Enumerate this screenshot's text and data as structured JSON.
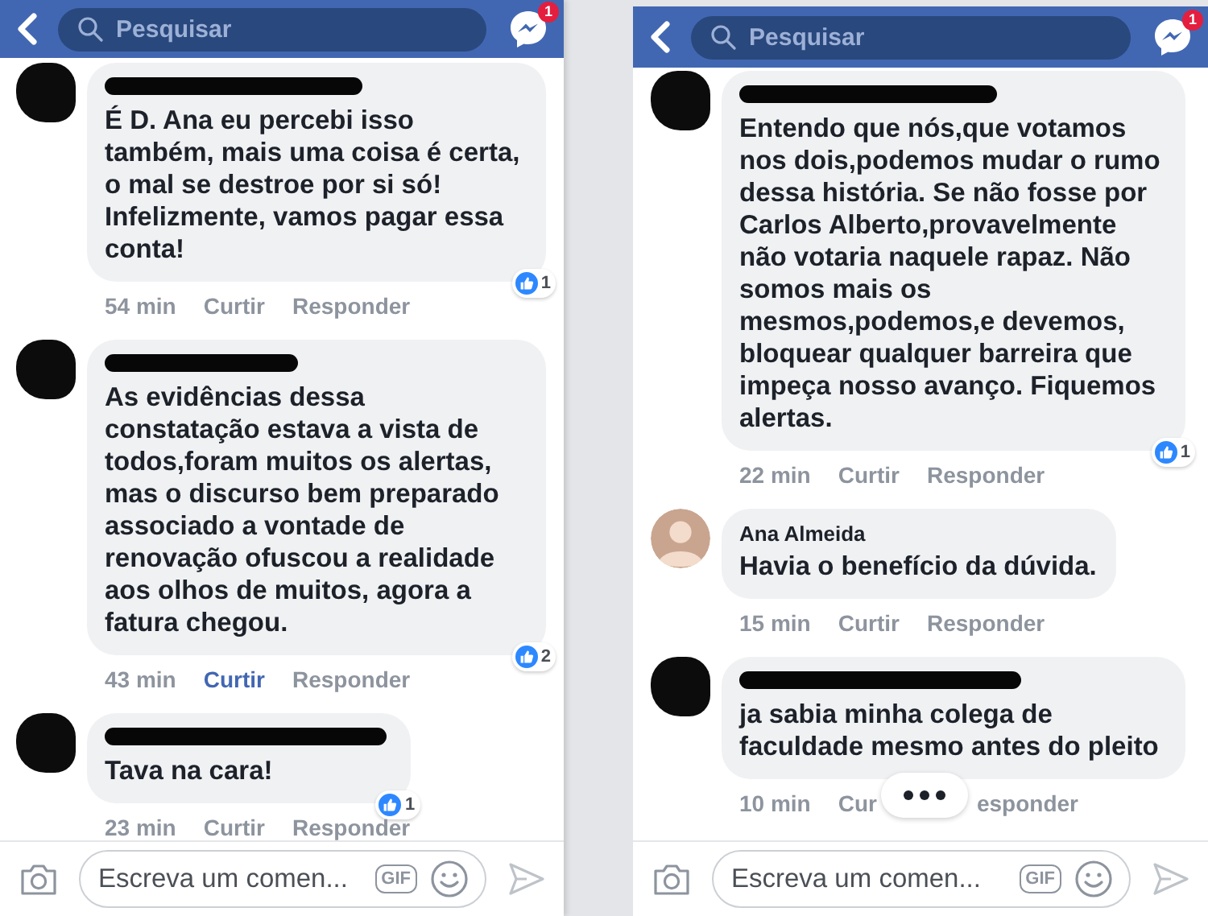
{
  "panels": [
    {
      "header": {
        "search_placeholder": "Pesquisar",
        "messenger_badge": "1"
      },
      "comments": [
        {
          "author_redacted": true,
          "text": "É D. Ana eu percebi isso também, mais uma coisa é certa, o mal se destroe por si só! Infelizmente, vamos pagar essa conta!",
          "time": "54 min",
          "like_label": "Curtir",
          "liked": false,
          "reply_label": "Responder",
          "reactions": "1"
        },
        {
          "author_redacted": true,
          "text": "As evidências dessa constatação estava a vista de todos,foram muitos os alertas, mas o discurso bem preparado associado a vontade de renovação ofuscou a realidade aos olhos de muitos, agora a fatura chegou.",
          "time": "43 min",
          "like_label": "Curtir",
          "liked": true,
          "reply_label": "Responder",
          "reactions": "2"
        },
        {
          "author_redacted": true,
          "text": "Tava na cara!",
          "time": "23 min",
          "like_label": "Curtir",
          "liked": false,
          "reply_label": "Responder",
          "reactions": "1"
        }
      ],
      "composer": {
        "placeholder": "Escreva um comen...",
        "gif_label": "GIF"
      }
    },
    {
      "header": {
        "search_placeholder": "Pesquisar",
        "messenger_badge": "1"
      },
      "comments": [
        {
          "author_redacted": true,
          "text": "Entendo que nós,que votamos nos dois,podemos mudar o rumo dessa história. Se não fosse por Carlos Alberto,provavelmente não votaria naquele rapaz. Não somos mais os mesmos,podemos,e devemos, bloquear qualquer barreira que impeça nosso avanço. Fiquemos alertas.",
          "time": "22 min",
          "like_label": "Curtir",
          "liked": false,
          "reply_label": "Responder",
          "reactions": "1"
        },
        {
          "author": "Ana Almeida",
          "author_redacted": false,
          "text": "Havia o benefício da dúvida.",
          "time": "15 min",
          "like_label": "Curtir",
          "liked": false,
          "reply_label": "Responder"
        },
        {
          "author_redacted": true,
          "text": "ja sabia minha colega de faculdade mesmo antes do pleito",
          "time": "10 min",
          "like_label": "Cur",
          "liked": false,
          "reply_label": "esponder",
          "more_button": true
        }
      ],
      "composer": {
        "placeholder": "Escreva um comen...",
        "gif_label": "GIF"
      }
    }
  ]
}
